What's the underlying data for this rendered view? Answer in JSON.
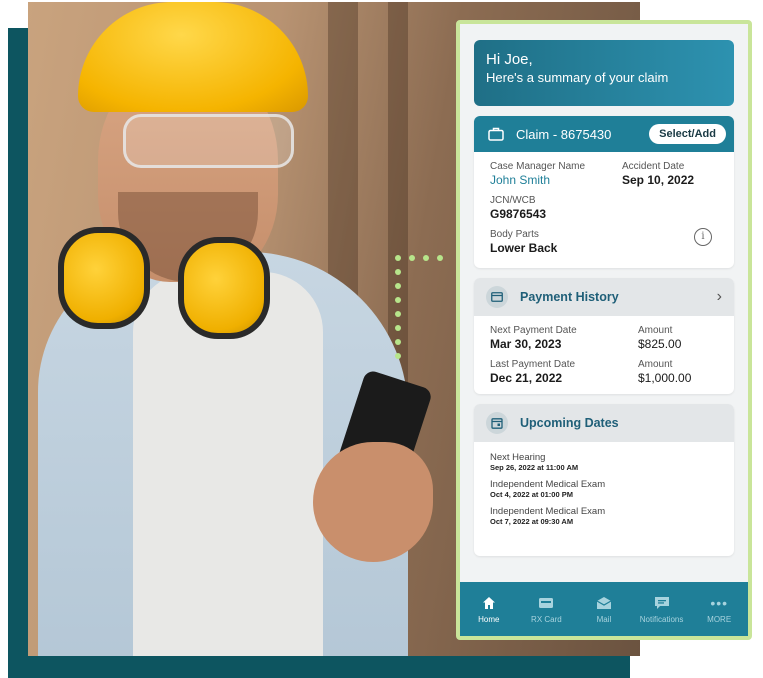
{
  "app": {
    "greeting_line1": "Hi Joe,",
    "greeting_line2": "Here's a summary of your claim",
    "claim": {
      "title": "Claim - 8675430",
      "select_label": "Select/Add",
      "case_manager_label": "Case Manager Name",
      "case_manager_value": "John Smith",
      "accident_date_label": "Accident Date",
      "accident_date_value": "Sep 10, 2022",
      "jcn_label": "JCN/WCB",
      "jcn_value": "G9876543",
      "body_parts_label": "Body Parts",
      "body_parts_value": "Lower Back"
    },
    "payment_history": {
      "title": "Payment History",
      "next_label": "Next Payment Date",
      "next_value": "Mar 30, 2023",
      "next_amount_label": "Amount",
      "next_amount_value": "$825.00",
      "last_label": "Last Payment Date",
      "last_value": "Dec 21, 2022",
      "last_amount_label": "Amount",
      "last_amount_value": "$1,000.00"
    },
    "upcoming_dates": {
      "title": "Upcoming Dates",
      "items": [
        {
          "label": "Next Hearing",
          "when": "Sep 26, 2022 at 11:00 AM"
        },
        {
          "label": "Independent Medical Exam",
          "when": "Oct 4, 2022 at 01:00 PM"
        },
        {
          "label": "Independent Medical Exam",
          "when": "Oct 7, 2022 at 09:30 AM"
        }
      ]
    },
    "nav": [
      {
        "label": "Home",
        "icon": "home-icon"
      },
      {
        "label": "RX Card",
        "icon": "rx-card-icon"
      },
      {
        "label": "Mail",
        "icon": "mail-icon"
      },
      {
        "label": "Notifications",
        "icon": "notifications-icon"
      },
      {
        "label": "MORE",
        "icon": "more-icon"
      }
    ]
  },
  "colors": {
    "brand_teal": "#1f7f98",
    "frame_green": "#c9e59a",
    "backdrop_teal": "#0d5560",
    "hardhat_yellow": "#f5b400"
  }
}
